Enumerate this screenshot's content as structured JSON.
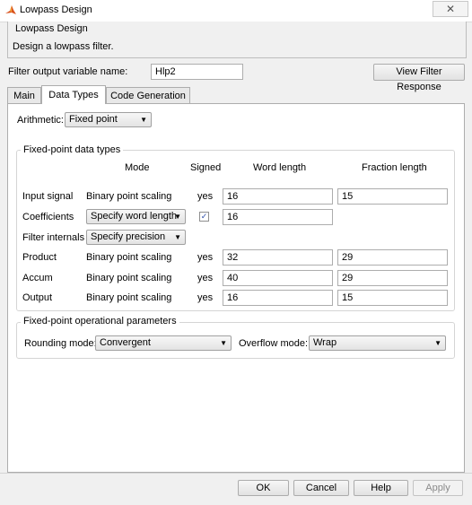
{
  "window": {
    "title": "Lowpass Design",
    "close_glyph": "✕",
    "icon": "matlab-logo-icon"
  },
  "header": {
    "group_title": "Lowpass Design",
    "description": "Design a lowpass filter."
  },
  "output_var": {
    "label": "Filter output variable name:",
    "value": "Hlp2"
  },
  "view_button": "View Filter Response",
  "tabs": [
    {
      "label": "Main",
      "active": false
    },
    {
      "label": "Data Types",
      "active": true
    },
    {
      "label": "Code Generation",
      "active": false
    }
  ],
  "arithmetic": {
    "label": "Arithmetic:",
    "value": "Fixed point"
  },
  "fixed_point": {
    "title": "Fixed-point data types",
    "columns": {
      "mode": "Mode",
      "signed": "Signed",
      "word": "Word length",
      "fraction": "Fraction length"
    },
    "rows": [
      {
        "label": "Input signal",
        "mode": "Binary point scaling",
        "signed": "yes",
        "word": "16",
        "fraction": "15"
      },
      {
        "label": "Coefficients",
        "mode": "Specify word length",
        "signed_checked": true,
        "word": "16"
      },
      {
        "label": "Filter internals",
        "mode": "Specify precision"
      },
      {
        "label": "Product",
        "mode": "Binary point scaling",
        "signed": "yes",
        "word": "32",
        "fraction": "29"
      },
      {
        "label": "Accum",
        "mode": "Binary point scaling",
        "signed": "yes",
        "word": "40",
        "fraction": "29"
      },
      {
        "label": "Output",
        "mode": "Binary point scaling",
        "signed": "yes",
        "word": "16",
        "fraction": "15"
      }
    ]
  },
  "operational": {
    "title": "Fixed-point operational parameters",
    "rounding_label": "Rounding mode:",
    "rounding_value": "Convergent",
    "overflow_label": "Overflow mode:",
    "overflow_value": "Wrap"
  },
  "footer": {
    "ok": "OK",
    "cancel": "Cancel",
    "help": "Help",
    "apply": "Apply"
  },
  "colors": {
    "accent_check": "#2d4ea8",
    "disabled_text": "#8a8a8a"
  }
}
